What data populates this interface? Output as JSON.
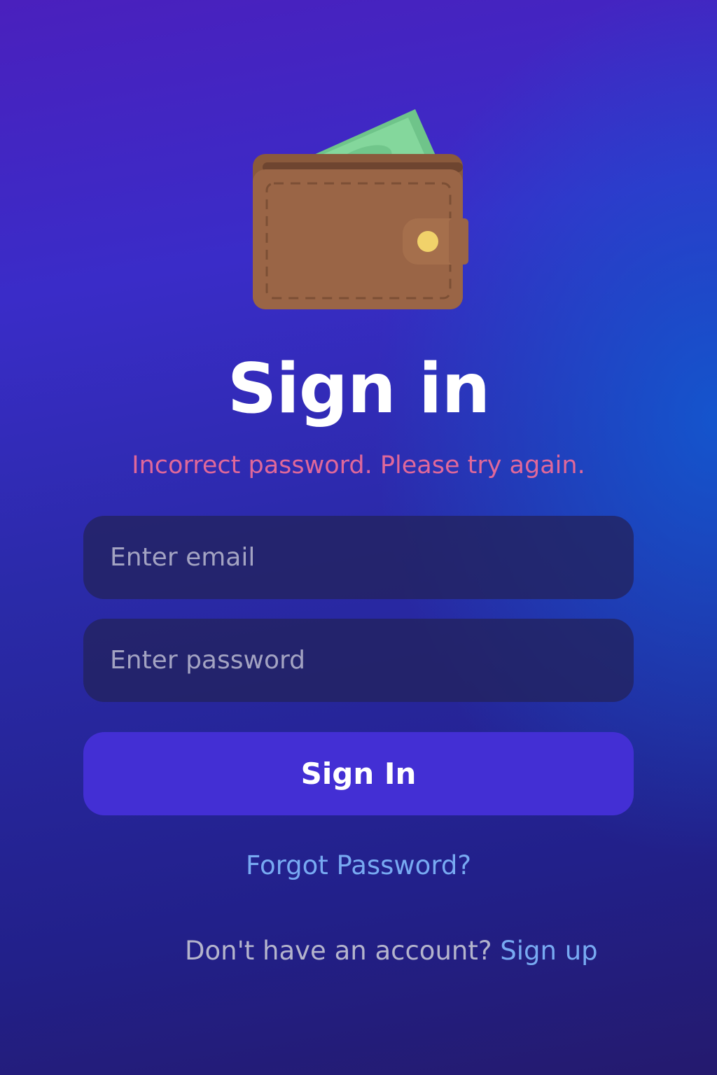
{
  "icons": {
    "app_logo": "wallet-icon"
  },
  "colors": {
    "error": "#e0689a",
    "link": "#78aaf2",
    "primary_button": "#432fd4",
    "title": "#ffffff"
  },
  "header": {
    "title": "Sign in"
  },
  "form": {
    "error_message": "Incorrect password. Please try again.",
    "email": {
      "value": "",
      "placeholder": "Enter email"
    },
    "password": {
      "value": "",
      "placeholder": "Enter password"
    },
    "submit_label": "Sign In"
  },
  "links": {
    "forgot_password": "Forgot Password?",
    "signup_prompt": "Don't have an account?",
    "signup_label": "Sign up"
  }
}
